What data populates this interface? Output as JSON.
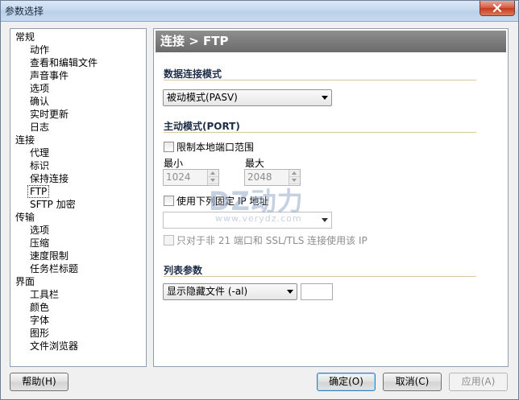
{
  "window": {
    "title": "参数选择"
  },
  "tree": [
    {
      "label": "常规",
      "level": 0
    },
    {
      "label": "动作",
      "level": 1
    },
    {
      "label": "查看和编辑文件",
      "level": 1
    },
    {
      "label": "声音事件",
      "level": 1
    },
    {
      "label": "选项",
      "level": 1
    },
    {
      "label": "确认",
      "level": 1
    },
    {
      "label": "实时更新",
      "level": 1
    },
    {
      "label": "日志",
      "level": 1
    },
    {
      "label": "连接",
      "level": 0
    },
    {
      "label": "代理",
      "level": 1
    },
    {
      "label": "标识",
      "level": 1
    },
    {
      "label": "保持连接",
      "level": 1
    },
    {
      "label": "FTP",
      "level": 1,
      "selected": true
    },
    {
      "label": "SFTP 加密",
      "level": 1
    },
    {
      "label": "传输",
      "level": 0
    },
    {
      "label": "选项",
      "level": 1
    },
    {
      "label": "压缩",
      "level": 1
    },
    {
      "label": "速度限制",
      "level": 1
    },
    {
      "label": "任务栏标题",
      "level": 1
    },
    {
      "label": "界面",
      "level": 0
    },
    {
      "label": "工具栏",
      "level": 1
    },
    {
      "label": "颜色",
      "level": 1
    },
    {
      "label": "字体",
      "level": 1
    },
    {
      "label": "图形",
      "level": 1
    },
    {
      "label": "文件浏览器",
      "level": 1
    }
  ],
  "panel": {
    "header": "连接 > FTP",
    "data_mode": {
      "title": "数据连接模式",
      "selected": "被动模式(PASV)"
    },
    "active_mode": {
      "title": "主动模式(PORT)",
      "limit_port_label": "限制本地端口范围",
      "min_label": "最小",
      "max_label": "最大",
      "min_value": "1024",
      "max_value": "2048",
      "use_ip_label": "使用下列固定 IP 地址",
      "only_for_label": "只对于非 21 端口和 SSL/TLS 连接使用该 IP"
    },
    "list_params": {
      "title": "列表参数",
      "selected": "显示隐藏文件 (-al)"
    }
  },
  "watermark": {
    "logo": "DZ动力",
    "url": "www.verydz.com"
  },
  "buttons": {
    "help": "帮助(H)",
    "ok": "确定(O)",
    "cancel": "取消(C)",
    "apply": "应用(A)"
  }
}
